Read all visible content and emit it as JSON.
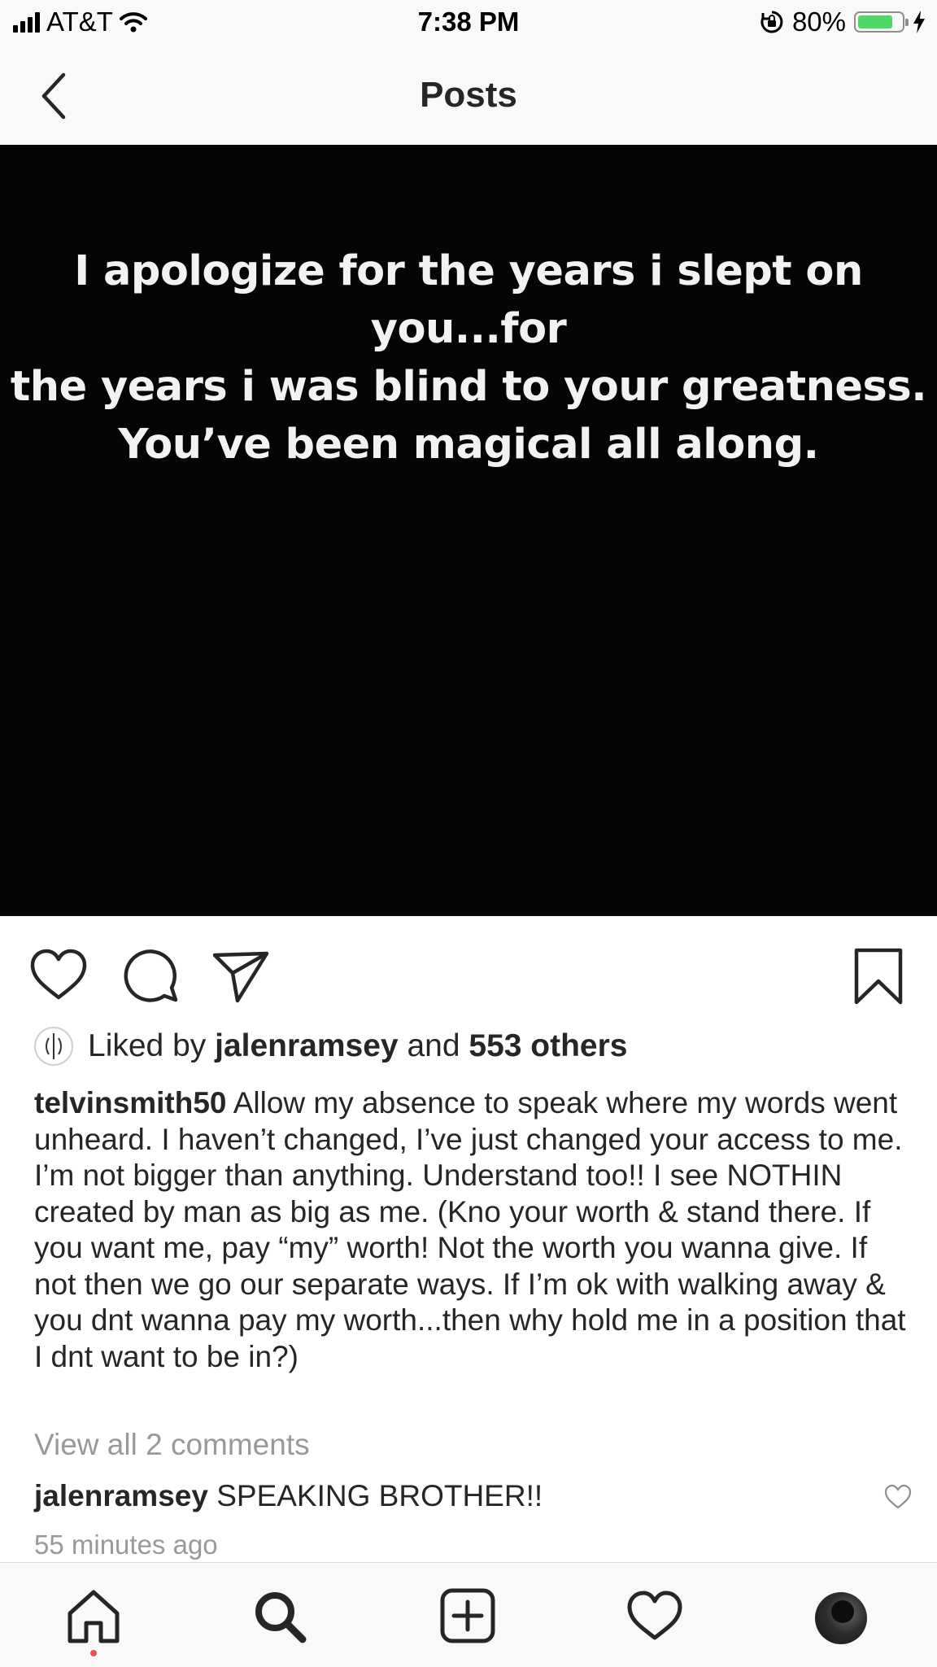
{
  "status_bar": {
    "carrier": "AT&T",
    "time": "7:38 PM",
    "battery_percent": "80%",
    "battery_level": 0.8,
    "battery_color": "#4cd964"
  },
  "header": {
    "title": "Posts",
    "back_icon": "chevron-left-icon"
  },
  "post": {
    "image_text": "I apologize for the years i slept on you...for\nthe years i was blind to your greatness.\nYou’ve been magical all along.",
    "actions": [
      "heart-icon",
      "comment-icon",
      "share-icon",
      "bookmark-icon"
    ],
    "likes": {
      "prefix": "Liked by",
      "user": "jalenramsey",
      "joiner": "and",
      "others": "553 others"
    },
    "caption": {
      "username": "telvinsmith50",
      "text": "Allow my absence to speak where my words went unheard. I haven’t changed, I’ve just changed your access to me. I’m not bigger than anything. Understand too!! I see NOTHIN created by man as big as me. (Kno your worth & stand there. If you want me, pay “my” worth! Not the worth you wanna give. If not then we go our separate ways. If I’m ok with walking away & you dnt wanna pay my worth...then why hold me in a position that I dnt want to be in?)"
    },
    "view_comments": "View all 2 comments",
    "comment": {
      "username": "jalenramsey",
      "text": "SPEAKING BROTHER!!"
    },
    "timestamp": "55 minutes ago"
  },
  "tab_bar": {
    "items": [
      "home-icon",
      "search-icon",
      "add-post-icon",
      "activity-heart-icon",
      "profile-avatar"
    ],
    "notification_color": "#ed4956"
  }
}
